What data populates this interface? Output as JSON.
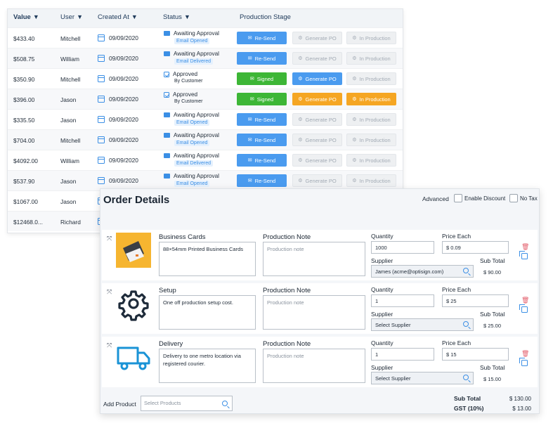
{
  "orders": {
    "headers": {
      "value": "Value",
      "user": "User",
      "created": "Created At",
      "status": "Status",
      "stage": "Production Stage"
    },
    "sort_arrow": "▼",
    "rows": [
      {
        "value": "$433.40",
        "user": "Mitchell",
        "date": "09/09/2020",
        "status": "Awaiting Approval",
        "sub": "Email Opened",
        "approved": false,
        "b1": "Re-Send",
        "b2": "Generate PO",
        "b3": "In Production",
        "b1_style": "blue",
        "b2_style": "grey",
        "b3_style": "grey"
      },
      {
        "value": "$508.75",
        "user": "William",
        "date": "09/09/2020",
        "status": "Awaiting Approval",
        "sub": "Email Delivered",
        "approved": false,
        "b1": "Re-Send",
        "b2": "Generate PO",
        "b3": "In Production",
        "b1_style": "blue",
        "b2_style": "grey",
        "b3_style": "grey"
      },
      {
        "value": "$350.90",
        "user": "Mitchell",
        "date": "09/09/2020",
        "status": "Approved",
        "sub": "By Customer",
        "approved": true,
        "b1": "Signed",
        "b2": "Generate PO",
        "b3": "In Production",
        "b1_style": "green",
        "b2_style": "blue",
        "b3_style": "grey"
      },
      {
        "value": "$396.00",
        "user": "Jason",
        "date": "09/09/2020",
        "status": "Approved",
        "sub": "By Customer",
        "approved": true,
        "b1": "Signed",
        "b2": "Generate PO",
        "b3": "In Production",
        "b1_style": "green",
        "b2_style": "orange",
        "b3_style": "orange"
      },
      {
        "value": "$335.50",
        "user": "Jason",
        "date": "09/09/2020",
        "status": "Awaiting Approval",
        "sub": "Email Opened",
        "approved": false,
        "b1": "Re-Send",
        "b2": "Generate PO",
        "b3": "In Production",
        "b1_style": "blue",
        "b2_style": "grey",
        "b3_style": "grey"
      },
      {
        "value": "$704.00",
        "user": "Mitchell",
        "date": "09/09/2020",
        "status": "Awaiting Approval",
        "sub": "Email Opened",
        "approved": false,
        "b1": "Re-Send",
        "b2": "Generate PO",
        "b3": "In Production",
        "b1_style": "blue",
        "b2_style": "grey",
        "b3_style": "grey"
      },
      {
        "value": "$4092.00",
        "user": "William",
        "date": "09/09/2020",
        "status": "Awaiting Approval",
        "sub": "Email Delivered",
        "approved": false,
        "b1": "Re-Send",
        "b2": "Generate PO",
        "b3": "In Production",
        "b1_style": "blue",
        "b2_style": "grey",
        "b3_style": "grey"
      },
      {
        "value": "$537.90",
        "user": "Jason",
        "date": "09/09/2020",
        "status": "Awaiting Approval",
        "sub": "Email Opened",
        "approved": false,
        "b1": "Re-Send",
        "b2": "Generate PO",
        "b3": "In Production",
        "b1_style": "blue",
        "b2_style": "grey",
        "b3_style": "grey"
      },
      {
        "value": "$1067.00",
        "user": "Jason",
        "date": "",
        "status": "",
        "sub": "",
        "approved": false,
        "b1": "",
        "b2": "",
        "b3": ""
      },
      {
        "value": "$12468.0...",
        "user": "Richard",
        "date": "",
        "status": "",
        "sub": "",
        "approved": false,
        "b1": "",
        "b2": "",
        "b3": ""
      }
    ]
  },
  "details": {
    "title": "Order Details",
    "advanced": "Advanced",
    "enable_discount": "Enable Discount",
    "no_tax": "No Tax",
    "items": [
      {
        "name": "Business Cards",
        "description": "88×54mm Printed Business Cards",
        "note_label": "Production Note",
        "note_placeholder": "Production note",
        "quantity_label": "Quantity",
        "quantity": "1000",
        "price_label": "Price Each",
        "price": "$ 0.09",
        "supplier_label": "Supplier",
        "supplier": "James (acme@optisign.com)",
        "subtotal_label": "Sub Total",
        "subtotal": "$ 90.00",
        "thumb": "business-card-thumbnail"
      },
      {
        "name": "Setup",
        "description": "One off production setup cost.",
        "note_label": "Production Note",
        "note_placeholder": "Production note",
        "quantity_label": "Quantity",
        "quantity": "1",
        "price_label": "Price Each",
        "price": "$ 25",
        "supplier_label": "Supplier",
        "supplier": "Select Supplier",
        "subtotal_label": "Sub Total",
        "subtotal": "$ 25.00",
        "thumb": "gear-icon"
      },
      {
        "name": "Delivery",
        "description": "Delivery to one metro location via registered courier.",
        "note_label": "Production Note",
        "note_placeholder": "Production note",
        "quantity_label": "Quantity",
        "quantity": "1",
        "price_label": "Price Each",
        "price": "$ 15",
        "supplier_label": "Supplier",
        "supplier": "Select Supplier",
        "subtotal_label": "Sub Total",
        "subtotal": "$ 15.00",
        "thumb": "delivery-truck-icon"
      }
    ],
    "add_product_label": "Add Product",
    "select_products_placeholder": "Select Products",
    "totals": [
      {
        "label": "Sub Total",
        "value": "$ 130.00"
      },
      {
        "label": "GST (10%)",
        "value": "$ 13.00"
      }
    ]
  },
  "colors": {
    "accent": "#4a9bef",
    "success": "#3db636",
    "warning": "#f5a623",
    "danger": "#e35d6a"
  }
}
